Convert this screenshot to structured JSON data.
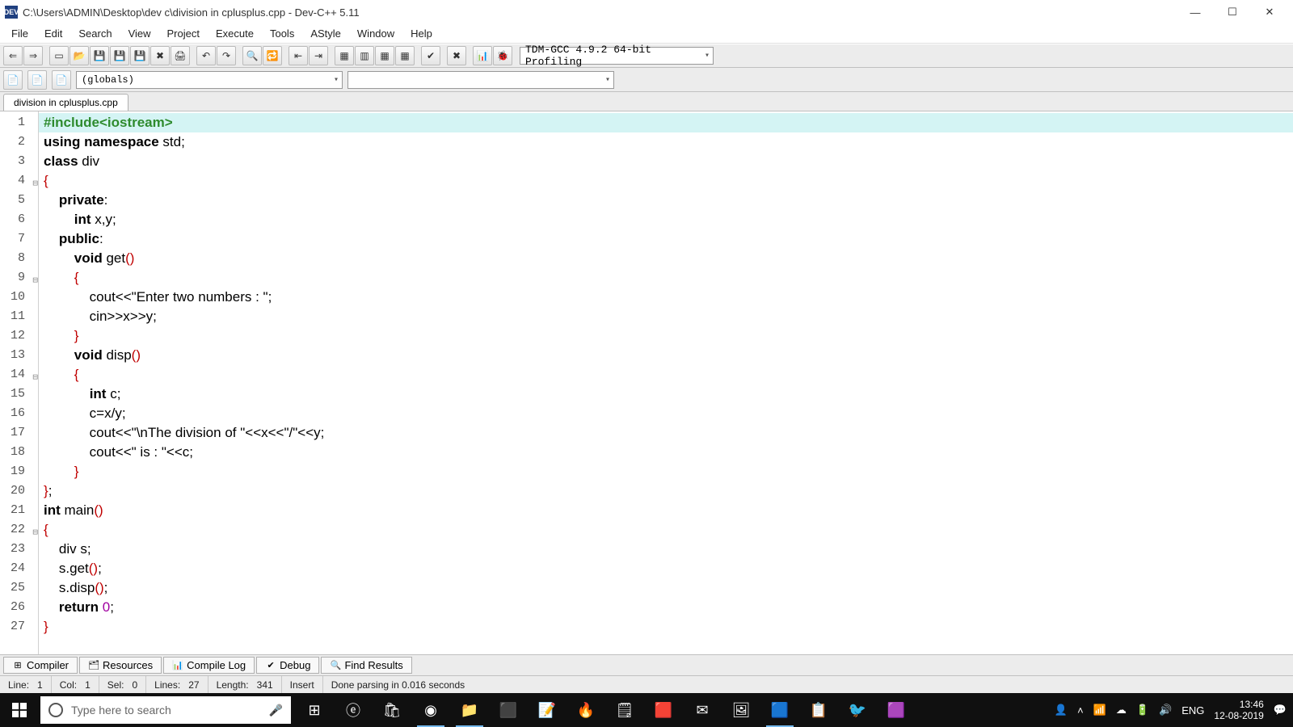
{
  "window": {
    "title": "C:\\Users\\ADMIN\\Desktop\\dev c\\division in cplusplus.cpp - Dev-C++ 5.11",
    "icon_label": "DEV"
  },
  "menu": [
    "File",
    "Edit",
    "Search",
    "View",
    "Project",
    "Execute",
    "Tools",
    "AStyle",
    "Window",
    "Help"
  ],
  "compiler_profile": "TDM-GCC 4.9.2 64-bit Profiling",
  "class_browser": "(globals)",
  "tab": "division in cplusplus.cpp",
  "code_lines": [
    {
      "n": 1,
      "fold": false,
      "hl": true,
      "html": "<span class='pre'>#include&lt;iostream&gt;</span>"
    },
    {
      "n": 2,
      "fold": false,
      "hl": false,
      "html": "<span class='kw'>using</span> <span class='kw'>namespace</span> std;"
    },
    {
      "n": 3,
      "fold": false,
      "hl": false,
      "html": "<span class='kw'>class</span> div"
    },
    {
      "n": 4,
      "fold": true,
      "hl": false,
      "html": "<span class='paren'>{</span>"
    },
    {
      "n": 5,
      "fold": false,
      "hl": false,
      "html": "    <span class='kw'>private</span>:"
    },
    {
      "n": 6,
      "fold": false,
      "hl": false,
      "html": "        <span class='kw'>int</span> x,y;"
    },
    {
      "n": 7,
      "fold": false,
      "hl": false,
      "html": "    <span class='kw'>public</span>:"
    },
    {
      "n": 8,
      "fold": false,
      "hl": false,
      "html": "        <span class='kw'>void</span> get<span class='paren'>()</span>"
    },
    {
      "n": 9,
      "fold": true,
      "hl": false,
      "html": "        <span class='paren'>{</span>"
    },
    {
      "n": 10,
      "fold": false,
      "hl": false,
      "html": "            cout&lt;&lt;<span class='str'>\"Enter two numbers : \"</span>;"
    },
    {
      "n": 11,
      "fold": false,
      "hl": false,
      "html": "            cin&gt;&gt;x&gt;&gt;y;"
    },
    {
      "n": 12,
      "fold": false,
      "hl": false,
      "html": "        <span class='paren'>}</span>"
    },
    {
      "n": 13,
      "fold": false,
      "hl": false,
      "html": "        <span class='kw'>void</span> disp<span class='paren'>()</span>"
    },
    {
      "n": 14,
      "fold": true,
      "hl": false,
      "html": "        <span class='paren'>{</span>"
    },
    {
      "n": 15,
      "fold": false,
      "hl": false,
      "html": "            <span class='kw'>int</span> c;"
    },
    {
      "n": 16,
      "fold": false,
      "hl": false,
      "html": "            c=x/y;"
    },
    {
      "n": 17,
      "fold": false,
      "hl": false,
      "html": "            cout&lt;&lt;<span class='str'>\"\\nThe division of \"</span>&lt;&lt;x&lt;&lt;<span class='str'>\"/\"</span>&lt;&lt;y;"
    },
    {
      "n": 18,
      "fold": false,
      "hl": false,
      "html": "            cout&lt;&lt;<span class='str'>\" is : \"</span>&lt;&lt;c;"
    },
    {
      "n": 19,
      "fold": false,
      "hl": false,
      "html": "        <span class='paren'>}</span>"
    },
    {
      "n": 20,
      "fold": false,
      "hl": false,
      "html": "<span class='paren'>}</span>;"
    },
    {
      "n": 21,
      "fold": false,
      "hl": false,
      "html": "<span class='kw'>int</span> main<span class='paren'>()</span>"
    },
    {
      "n": 22,
      "fold": true,
      "hl": false,
      "html": "<span class='paren'>{</span>"
    },
    {
      "n": 23,
      "fold": false,
      "hl": false,
      "html": "    div s;"
    },
    {
      "n": 24,
      "fold": false,
      "hl": false,
      "html": "    s.get<span class='paren'>()</span>;"
    },
    {
      "n": 25,
      "fold": false,
      "hl": false,
      "html": "    s.disp<span class='paren'>()</span>;"
    },
    {
      "n": 26,
      "fold": false,
      "hl": false,
      "html": "    <span class='kw'>return</span> <span class='num'>0</span>;"
    },
    {
      "n": 27,
      "fold": false,
      "hl": false,
      "html": "<span class='paren'>}</span>"
    }
  ],
  "bottom_tabs": [
    {
      "icon": "⊞",
      "label": "Compiler"
    },
    {
      "icon": "🗂",
      "label": "Resources"
    },
    {
      "icon": "📊",
      "label": "Compile Log"
    },
    {
      "icon": "✔",
      "label": "Debug"
    },
    {
      "icon": "🔍",
      "label": "Find Results"
    }
  ],
  "status": {
    "line_label": "Line:",
    "line": "1",
    "col_label": "Col:",
    "col": "1",
    "sel_label": "Sel:",
    "sel": "0",
    "lines_label": "Lines:",
    "lines": "27",
    "length_label": "Length:",
    "length": "341",
    "mode": "Insert",
    "msg": "Done parsing in 0.016 seconds"
  },
  "taskbar": {
    "search_placeholder": "Type here to search",
    "lang": "ENG",
    "time": "13:46",
    "date": "12-08-2019"
  }
}
